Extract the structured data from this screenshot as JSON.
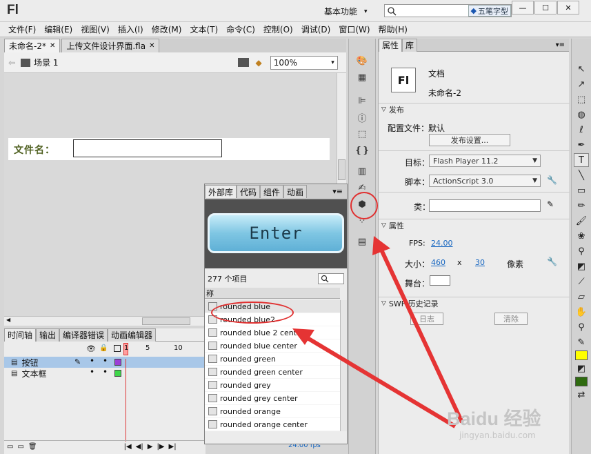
{
  "app": {
    "logo": "Fl",
    "workspace": "基本功能",
    "ime_badge": "五笔字型"
  },
  "window_buttons": [
    "—",
    "☐",
    "✕"
  ],
  "menu": [
    "文件(F)",
    "编辑(E)",
    "视图(V)",
    "插入(I)",
    "修改(M)",
    "文本(T)",
    "命令(C)",
    "控制(O)",
    "调试(D)",
    "窗口(W)",
    "帮助(H)"
  ],
  "doc_tabs": [
    {
      "label": "未命名-2*"
    },
    {
      "label": "上传文件设计界面.fla"
    }
  ],
  "scene": {
    "label": "场景 1",
    "zoom": "100%"
  },
  "stage": {
    "file_label": "文件名："
  },
  "timeline": {
    "tabs": [
      "时间轴",
      "输出",
      "编译器错误",
      "动画编辑器"
    ],
    "frame_numbers": [
      "1",
      "5",
      "10"
    ],
    "layers": [
      {
        "name": "按钮",
        "selected": true,
        "color": "#9b3fd6"
      },
      {
        "name": "文本框",
        "selected": false,
        "color": "#3fd64a"
      }
    ],
    "fps": "24.00 fps"
  },
  "library": {
    "tabs": [
      "外部库",
      "代码",
      "组件",
      "动画"
    ],
    "preview_text": "Enter",
    "count": "277 个项目",
    "col_header": "称",
    "items": [
      "rounded blue",
      "rounded blue2",
      "rounded blue 2 center",
      "rounded blue center",
      "rounded green",
      "rounded green center",
      "rounded grey",
      "rounded grey center",
      "rounded orange",
      "rounded orange center"
    ]
  },
  "props": {
    "tabs": [
      "属性",
      "库"
    ],
    "doc_label": "文档",
    "doc_name": "未命名-2",
    "doc_icon": "Fl",
    "publish_section": "发布",
    "profile_label": "配置文件：",
    "profile_value": "默认",
    "publish_settings": "发布设置...",
    "target_label": "目标：",
    "target_value": "Flash Player 11.2",
    "script_label": "脚本：",
    "script_value": "ActionScript 3.0",
    "class_label": "类：",
    "attrs_section": "属性",
    "fps_label": "FPS:",
    "fps_value": "24.00",
    "size_label": "大小：",
    "width": "460",
    "x_sep": "x",
    "height": "30",
    "unit": "像素",
    "stage_label": "舞台：",
    "swf_section": "SWF 历史记录",
    "log_button": "日志",
    "clear_button": "清除"
  },
  "watermark": {
    "brand": "Baidu 经验",
    "url": "jingyan.baidu.com"
  }
}
